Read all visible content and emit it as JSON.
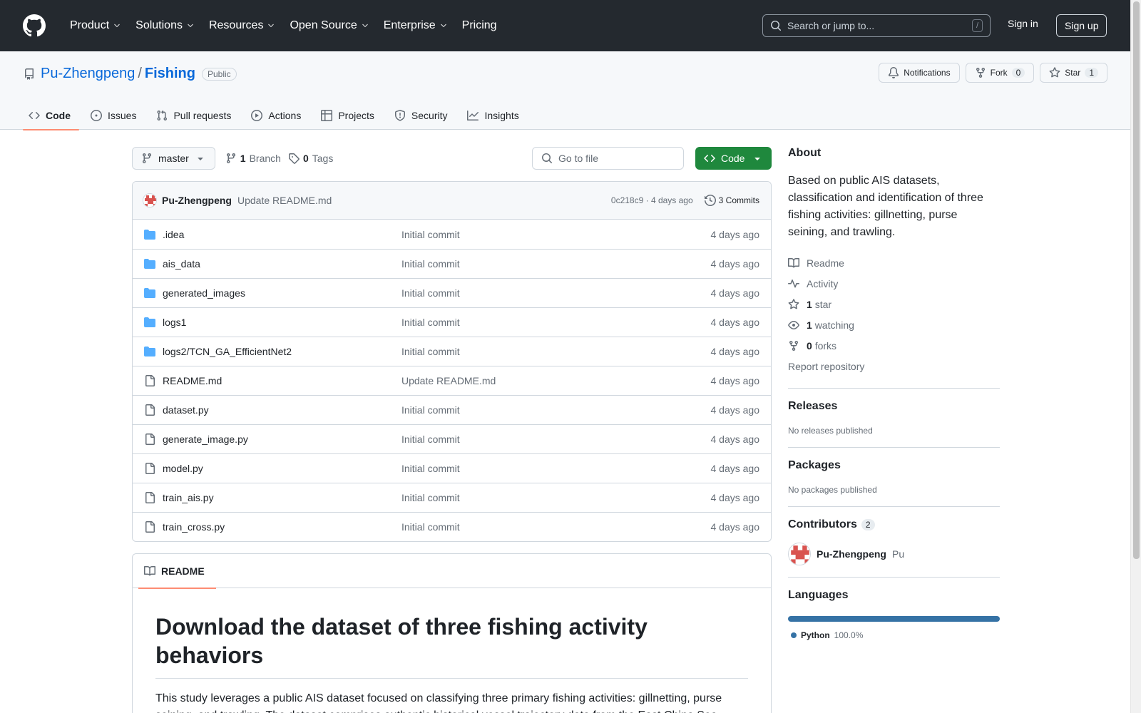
{
  "header": {
    "nav": [
      "Product",
      "Solutions",
      "Resources",
      "Open Source",
      "Enterprise",
      "Pricing"
    ],
    "search_placeholder": "Search or jump to...",
    "search_shortcut": "/",
    "sign_in": "Sign in",
    "sign_up": "Sign up"
  },
  "repo": {
    "owner": "Pu-Zhengpeng",
    "slash": "/",
    "name": "Fishing",
    "visibility": "Public",
    "notifications_label": "Notifications",
    "fork_label": "Fork",
    "fork_count": "0",
    "star_label": "Star",
    "star_count": "1",
    "tabs": [
      "Code",
      "Issues",
      "Pull requests",
      "Actions",
      "Projects",
      "Security",
      "Insights"
    ]
  },
  "toolbar": {
    "branch": "master",
    "branch_count": "1",
    "branch_label": "Branch",
    "tag_count": "0",
    "tag_label": "Tags",
    "goto_placeholder": "Go to file",
    "code_button": "Code"
  },
  "last_commit": {
    "author": "Pu-Zhengpeng",
    "message": "Update README.md",
    "sha_time": "0c218c9 · 4 days ago",
    "commits": "3 Commits"
  },
  "files": [
    {
      "type": "dir",
      "name": ".idea",
      "message": "Initial commit",
      "date": "4 days ago"
    },
    {
      "type": "dir",
      "name": "ais_data",
      "message": "Initial commit",
      "date": "4 days ago"
    },
    {
      "type": "dir",
      "name": "generated_images",
      "message": "Initial commit",
      "date": "4 days ago"
    },
    {
      "type": "dir",
      "name": "logs1",
      "message": "Initial commit",
      "date": "4 days ago"
    },
    {
      "type": "dir",
      "name": "logs2/TCN_GA_EfficientNet2",
      "message": "Initial commit",
      "date": "4 days ago"
    },
    {
      "type": "file",
      "name": "README.md",
      "message": "Update README.md",
      "date": "4 days ago"
    },
    {
      "type": "file",
      "name": "dataset.py",
      "message": "Initial commit",
      "date": "4 days ago"
    },
    {
      "type": "file",
      "name": "generate_image.py",
      "message": "Initial commit",
      "date": "4 days ago"
    },
    {
      "type": "file",
      "name": "model.py",
      "message": "Initial commit",
      "date": "4 days ago"
    },
    {
      "type": "file",
      "name": "train_ais.py",
      "message": "Initial commit",
      "date": "4 days ago"
    },
    {
      "type": "file",
      "name": "train_cross.py",
      "message": "Initial commit",
      "date": "4 days ago"
    }
  ],
  "readme": {
    "tab": "README",
    "heading": "Download the dataset of three fishing activity behaviors",
    "paragraph": "This study leverages a public AIS dataset focused on classifying three primary fishing activities: gillnetting, purse seining, and trawling. The dataset comprises authentic historical vessel trajectory data from the East China Sea"
  },
  "sidebar": {
    "about_title": "About",
    "about_text": "Based on public AIS datasets, classification and identification of three fishing activities: gillnetting, purse seining, and trawling.",
    "readme": "Readme",
    "activity": "Activity",
    "stars_count": "1",
    "stars_label": "star",
    "watching_count": "1",
    "watching_label": "watching",
    "forks_count": "0",
    "forks_label": "forks",
    "report": "Report repository",
    "releases_title": "Releases",
    "releases_text": "No releases published",
    "packages_title": "Packages",
    "packages_text": "No packages published",
    "contributors_title": "Contributors",
    "contributors_count": "2",
    "contributor_name": "Pu-Zhengpeng",
    "contributor_alias": "Pu",
    "languages_title": "Languages",
    "language_name": "Python",
    "language_pct": "100.0%",
    "language_color": "#3572A5"
  }
}
